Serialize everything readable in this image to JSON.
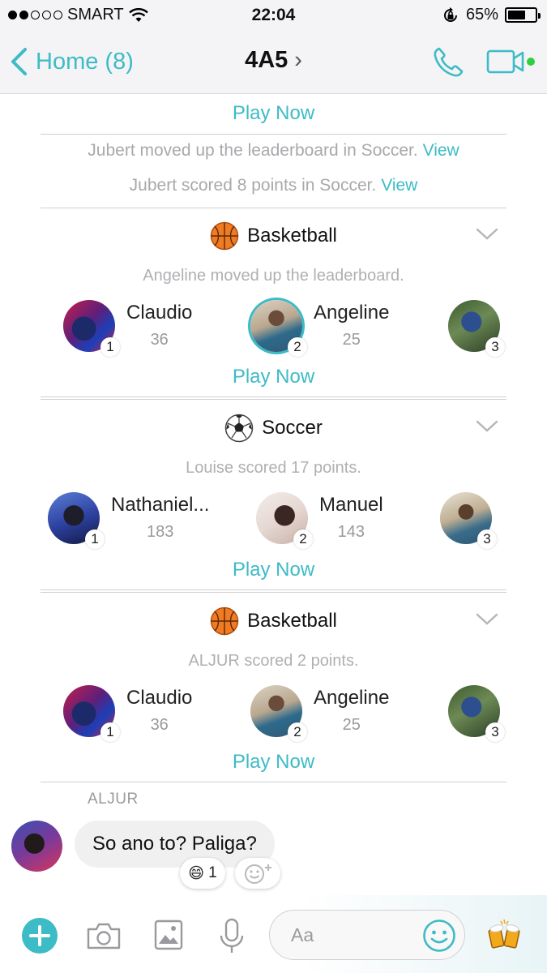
{
  "status_bar": {
    "carrier": "SMART",
    "time": "22:04",
    "battery": "65%",
    "battery_level": 0.65
  },
  "nav": {
    "back_label": "Home (8)",
    "title": "4A5",
    "title_chevron": "›"
  },
  "feed": {
    "top_play_now": "Play Now",
    "notices": [
      {
        "text": "Jubert moved up the leaderboard in Soccer.",
        "link": "View"
      },
      {
        "text": "Jubert scored 8 points in Soccer.",
        "link": "View"
      }
    ],
    "games": [
      {
        "name": "Basketball",
        "icon": "basketball-icon",
        "subtitle": "Angeline moved up the leaderboard.",
        "play_label": "Play Now",
        "players": [
          {
            "name": "Claudio",
            "score": "36",
            "rank": "1"
          },
          {
            "name": "Angeline",
            "score": "25",
            "rank": "2"
          },
          {
            "name": "",
            "score": "",
            "rank": "3"
          }
        ]
      },
      {
        "name": "Soccer",
        "icon": "soccer-ball-icon",
        "subtitle": "Louise scored 17 points.",
        "play_label": "Play Now",
        "players": [
          {
            "name": "Nathaniel...",
            "score": "183",
            "rank": "1"
          },
          {
            "name": "Manuel",
            "score": "143",
            "rank": "2"
          },
          {
            "name": "",
            "score": "",
            "rank": "3"
          }
        ]
      },
      {
        "name": "Basketball",
        "icon": "basketball-icon",
        "subtitle": "ALJUR scored 2 points.",
        "play_label": "Play Now",
        "players": [
          {
            "name": "Claudio",
            "score": "36",
            "rank": "1"
          },
          {
            "name": "Angeline",
            "score": "25",
            "rank": "2"
          },
          {
            "name": "",
            "score": "",
            "rank": "3"
          }
        ]
      }
    ]
  },
  "message": {
    "sender": "ALJUR",
    "text": "So ano to? Paliga?",
    "reaction_emoji": "😄",
    "reaction_count": "1",
    "add_reaction_icon": "add-reaction-icon"
  },
  "composer": {
    "placeholder": "Aa"
  },
  "colors": {
    "accent": "#3dbbc6",
    "online": "#2fcf3f"
  }
}
